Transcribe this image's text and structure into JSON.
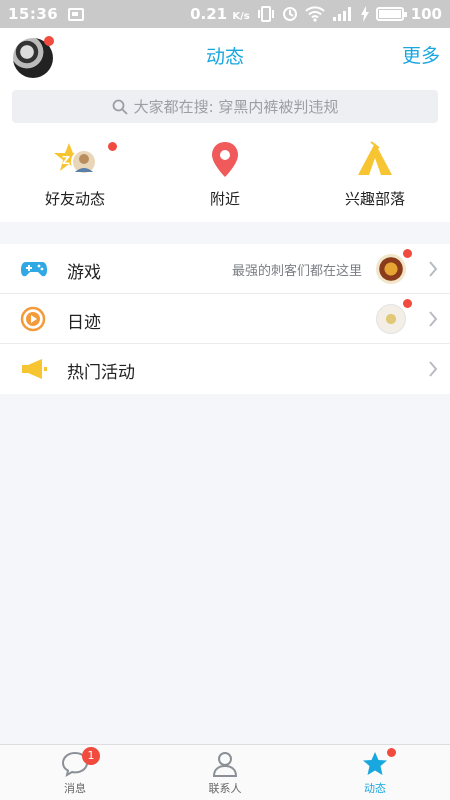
{
  "status_bar": {
    "time": "15:36",
    "speed": "0.21",
    "speed_unit": "K/s",
    "battery": "100"
  },
  "header": {
    "title": "动态",
    "more": "更多"
  },
  "search": {
    "placeholder": "大家都在搜: 穿黑内裤被判违规"
  },
  "quick_actions": [
    {
      "label": "好友动态",
      "icon": "friends-star-icon"
    },
    {
      "label": "附近",
      "icon": "location-pin-icon"
    },
    {
      "label": "兴趣部落",
      "icon": "tent-icon"
    }
  ],
  "list": [
    {
      "label": "游戏",
      "subtitle": "最强的刺客们都在这里",
      "icon": "gamepad-icon"
    },
    {
      "label": "日迹",
      "subtitle": "",
      "icon": "play-circle-icon"
    },
    {
      "label": "热门活动",
      "subtitle": "",
      "icon": "megaphone-icon"
    }
  ],
  "tabs": [
    {
      "label": "消息",
      "badge": "1",
      "icon": "chat-bubble-icon"
    },
    {
      "label": "联系人",
      "icon": "person-icon"
    },
    {
      "label": "动态",
      "icon": "star-icon"
    }
  ],
  "colors": {
    "accent": "#19a7df",
    "badge": "#f04b3e",
    "location": "#f05a5b",
    "tent": "#f7c531",
    "play": "#f39a3a"
  }
}
